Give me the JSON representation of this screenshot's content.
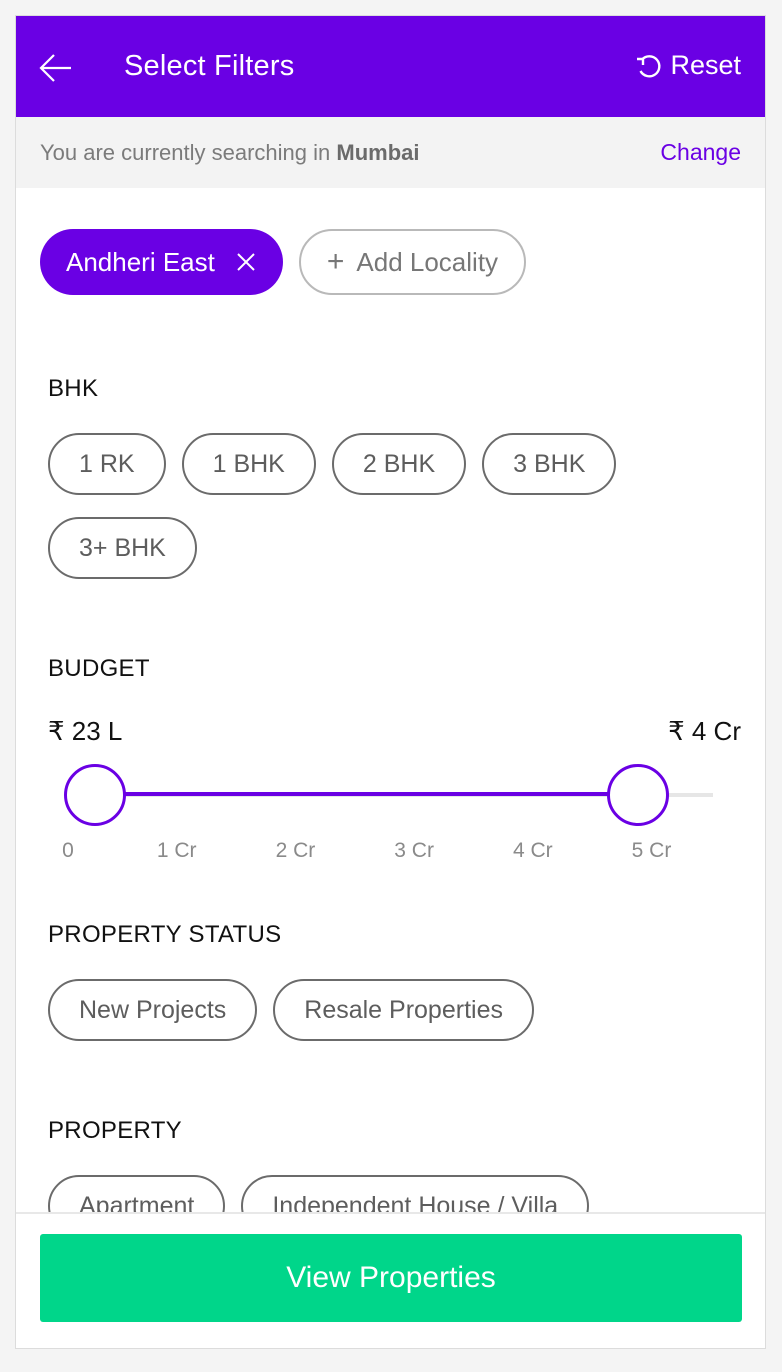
{
  "header": {
    "title": "Select Filters",
    "reset_label": "Reset",
    "back_icon": "arrow-left-icon",
    "reset_icon": "refresh-ccw-icon"
  },
  "location": {
    "prefix": "You are currently searching in",
    "city": "Mumbai",
    "change_label": "Change"
  },
  "localities": {
    "selected": [
      {
        "label": "Andheri East"
      }
    ],
    "add_label": "Add Locality"
  },
  "bhk": {
    "title": "BHK",
    "options": [
      "1 RK",
      "1 BHK",
      "2 BHK",
      "3 BHK",
      "3+ BHK"
    ]
  },
  "budget": {
    "title": "BUDGET",
    "min_label": "₹ 23 L",
    "max_label": "₹ 4 Cr",
    "min_value_cr": 0.23,
    "max_value_cr": 4.8,
    "range_cr": [
      0,
      5.4
    ],
    "ticks": [
      {
        "label": "0",
        "value": 0
      },
      {
        "label": "1 Cr",
        "value": 1
      },
      {
        "label": "2 Cr",
        "value": 2
      },
      {
        "label": "3 Cr",
        "value": 3
      },
      {
        "label": "4 Cr",
        "value": 4
      },
      {
        "label": "5 Cr",
        "value": 5
      }
    ]
  },
  "property_status": {
    "title": "PROPERTY STATUS",
    "options": [
      "New Projects",
      "Resale Properties"
    ]
  },
  "property": {
    "title": "PROPERTY",
    "options": [
      "Apartment",
      "Independent House / Villa"
    ]
  },
  "footer": {
    "view_label": "View Properties"
  },
  "colors": {
    "accent": "#6a00e4",
    "cta": "#00d68a"
  }
}
